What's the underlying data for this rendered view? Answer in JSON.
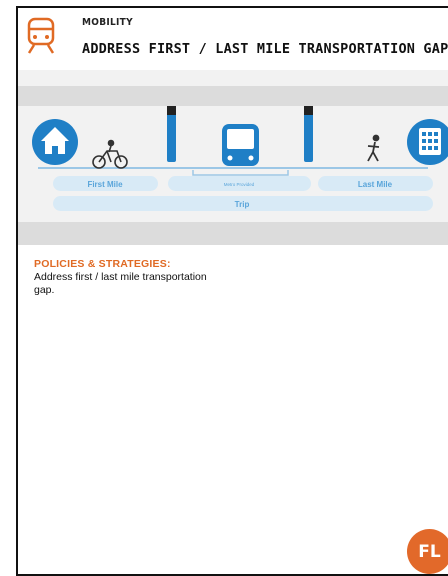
{
  "header": {
    "category": "MOBILITY",
    "headline": "ADDRESS FIRST / LAST MILE TRANSPORTATION GAP"
  },
  "diagram": {
    "first_mile_label": "First Mile",
    "metro_provided_label": "Metro Provided",
    "last_mile_label": "Last Mile",
    "trip_label": "Trip"
  },
  "policies": {
    "title": "POLICIES & STRATEGIES:",
    "body": "Address first / last mile transportation gap."
  },
  "badge": {
    "code": "FL"
  },
  "colors": {
    "accent": "#e06a24",
    "diagram_blue": "#1f7fc6",
    "light_blue": "#d8eaf6"
  }
}
